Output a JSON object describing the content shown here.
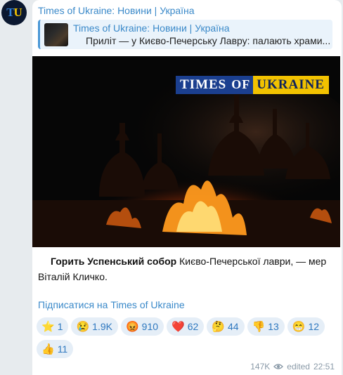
{
  "channel": {
    "name": "Times of Ukraine: Новини | Україна",
    "avatar_initials": [
      "T",
      "U"
    ]
  },
  "reply": {
    "title": "Times of Ukraine: Новини | Україна",
    "text": "Приліт — у Києво-Печерську Лавру: палають храми..."
  },
  "media": {
    "brand": [
      "TIMES",
      "OF",
      "UKRAINE"
    ],
    "brand_colors": {
      "blue": "#1b3f8f",
      "yellow": "#f2c200"
    }
  },
  "caption": {
    "bold": "Горить Успенський собор",
    "rest": " Києво-Печерської лаври, — мер Віталій Кличко."
  },
  "subscribe_link": "Підписатися на Times of Ukraine",
  "reactions": [
    {
      "emoji": "⭐",
      "count": "1"
    },
    {
      "emoji": "😢",
      "count": "1.9K"
    },
    {
      "emoji": "😡",
      "count": "910"
    },
    {
      "emoji": "❤️",
      "count": "62"
    },
    {
      "emoji": "🤔",
      "count": "44"
    },
    {
      "emoji": "👎",
      "count": "13"
    },
    {
      "emoji": "😁",
      "count": "12"
    },
    {
      "emoji": "👍",
      "count": "11"
    }
  ],
  "meta": {
    "views": "147K",
    "edited": "edited",
    "time": "22:51"
  },
  "colors": {
    "link": "#3a89c9",
    "background": "#e7ebee",
    "reaction_bg": "#e5eef7"
  }
}
